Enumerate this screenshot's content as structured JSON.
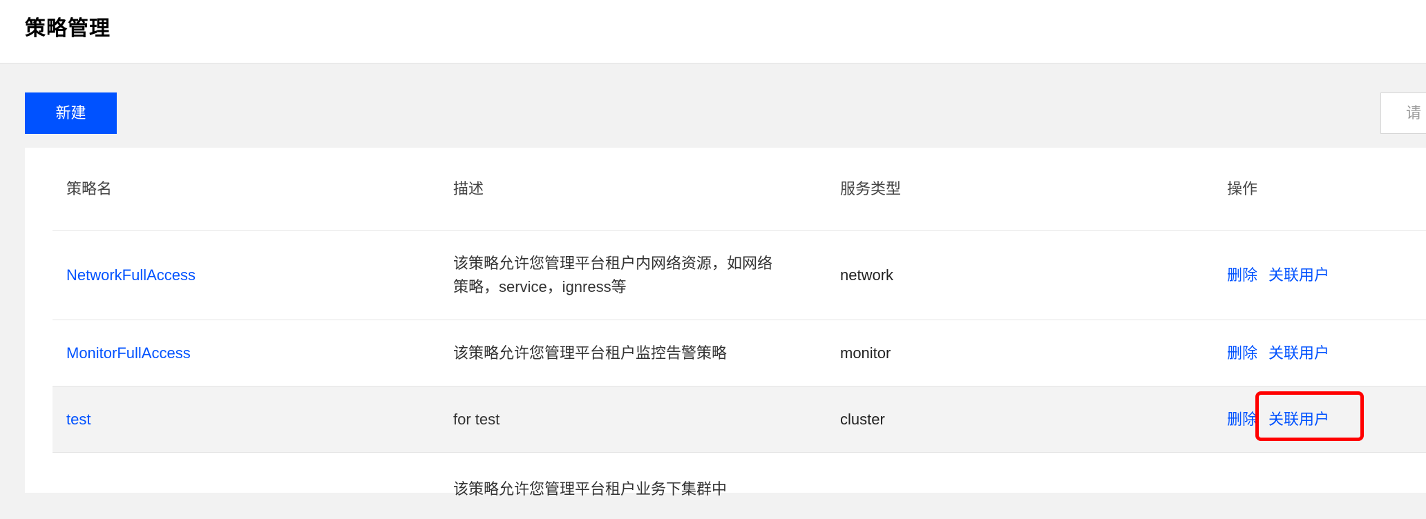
{
  "header": {
    "title": "策略管理"
  },
  "toolbar": {
    "new_label": "新建",
    "search_placeholder": "请"
  },
  "table": {
    "columns": [
      "策略名",
      "描述",
      "服务类型",
      "操作"
    ],
    "rows": [
      {
        "name": "NetworkFullAccess",
        "desc_line1": "该策略允许您管理平台租户内网络资源，如网络",
        "desc_line2": "策略，service，ignress等",
        "service": "network",
        "op_delete": "删除",
        "op_assoc": "关联用户"
      },
      {
        "name": "MonitorFullAccess",
        "desc": "该策略允许您管理平台租户监控告警策略",
        "service": "monitor",
        "op_delete": "删除",
        "op_assoc": "关联用户"
      },
      {
        "name": "test",
        "desc": "for test",
        "service": "cluster",
        "op_delete": "删除",
        "op_assoc": "关联用户"
      },
      {
        "desc": "该策略允许您管理平台租户业务下集群中"
      }
    ]
  },
  "colors": {
    "accent": "#0052ff",
    "highlight": "#ff0000",
    "hover_row": "#f3f3f3"
  }
}
